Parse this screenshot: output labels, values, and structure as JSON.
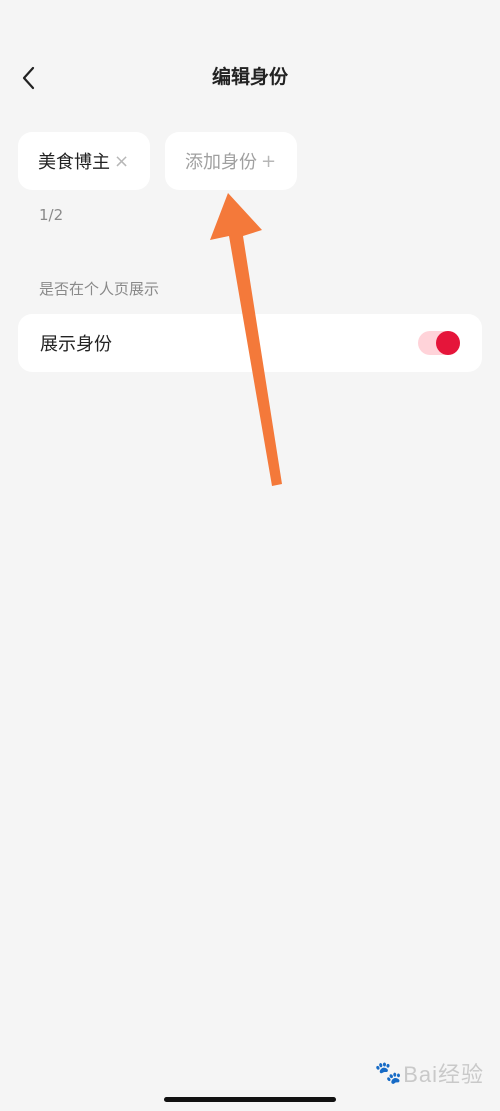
{
  "header": {
    "back_icon": "chevron-left-icon",
    "title": "编辑身份"
  },
  "identities": [
    {
      "label": "美食博主",
      "action_icon": "close-icon",
      "action_glyph": "×"
    },
    {
      "label": "添加身份",
      "action_icon": "plus-icon",
      "action_glyph": "+"
    }
  ],
  "count": "1/2",
  "section": {
    "label": "是否在个人页展示"
  },
  "setting": {
    "label": "展示身份",
    "toggle_on": true
  },
  "annotation": {
    "arrow_color": "#f4793a"
  },
  "watermark": {
    "text": "Bai经验"
  },
  "colors": {
    "accent": "#e5153a",
    "background": "#f5f5f5"
  }
}
